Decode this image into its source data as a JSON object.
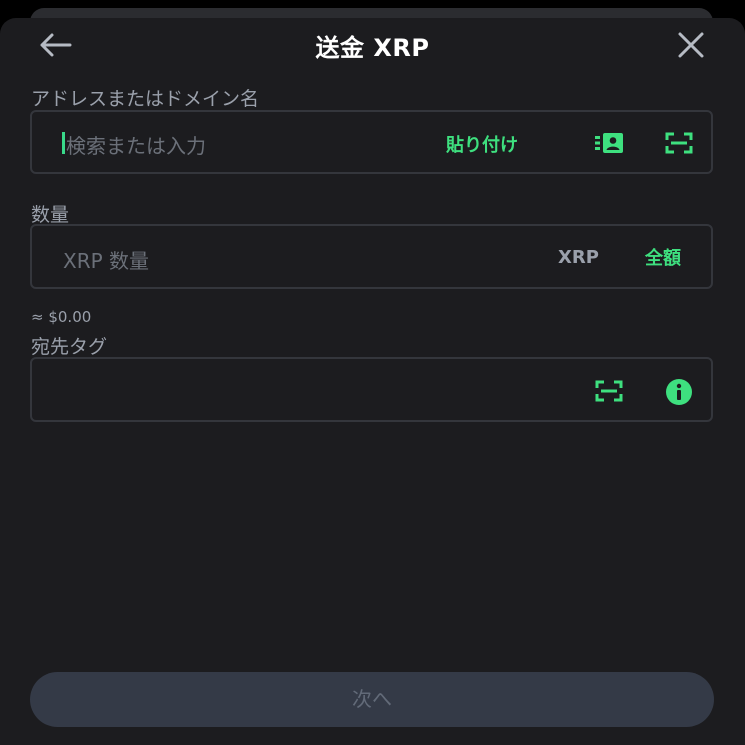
{
  "header": {
    "title": "送金 XRP",
    "back_icon": "arrow-left-icon",
    "close_icon": "close-icon"
  },
  "address": {
    "label": "アドレスまたはドメイン名",
    "placeholder": "検索または入力",
    "paste_label": "貼り付け",
    "contacts_icon": "contact-card-icon",
    "scan_icon": "qr-scan-icon"
  },
  "amount": {
    "label": "数量",
    "placeholder": "XRP 数量",
    "unit": "XRP",
    "max_label": "全額",
    "fiat_value": "≈ $0.00"
  },
  "tag": {
    "label": "宛先タグ",
    "value": "",
    "scan_icon": "qr-scan-icon",
    "info_icon": "info-icon"
  },
  "footer": {
    "next_label": "次へ"
  },
  "colors": {
    "accent": "#3ee07f",
    "background": "#1c1c1f",
    "field_border": "#34363c",
    "disabled_button": "#343a47"
  }
}
